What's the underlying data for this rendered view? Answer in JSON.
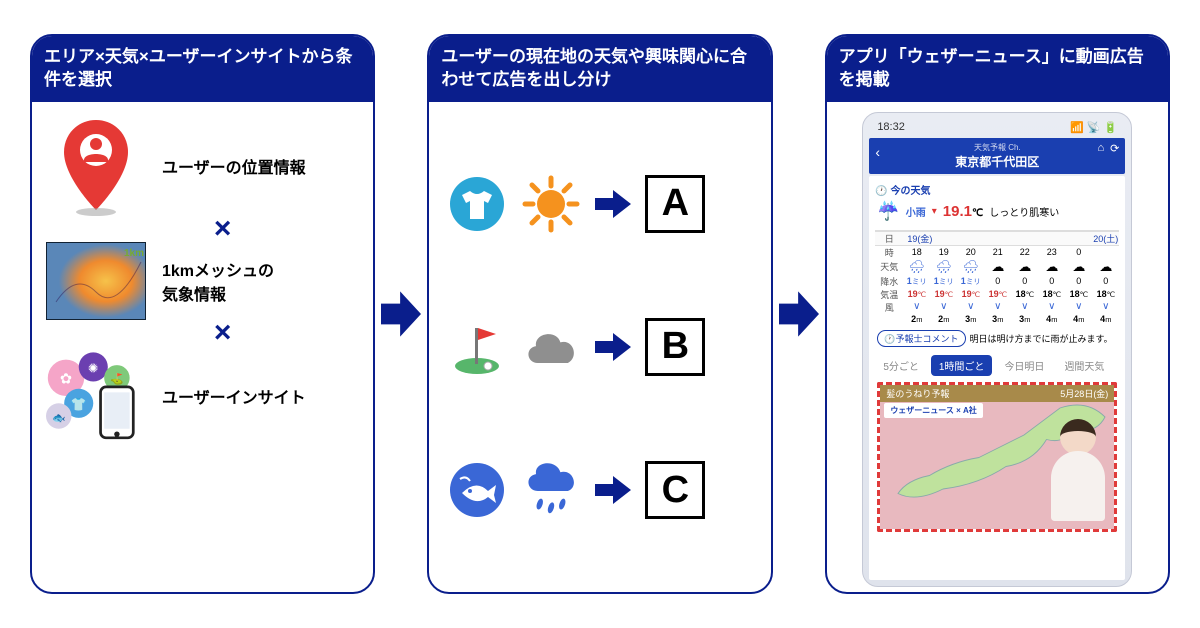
{
  "panel1": {
    "header": "エリア×天気×ユーザーインサイトから条件を選択",
    "row1_label": "ユーザーの位置情報",
    "row2_label": "1kmメッシュの\n気象情報",
    "row3_label": "ユーザーインサイト",
    "map_badge": "1km",
    "sep": "×"
  },
  "panel2": {
    "header": "ユーザーの現在地の天気や興味関心に合わせて広告を出し分け",
    "rows": [
      {
        "insight_icon": "tshirt",
        "weather_icon": "sun",
        "ad": "A"
      },
      {
        "insight_icon": "golf",
        "weather_icon": "cloud",
        "ad": "B"
      },
      {
        "insight_icon": "fish",
        "weather_icon": "rain",
        "ad": "C"
      }
    ]
  },
  "panel3": {
    "header": "アプリ「ウェザーニュース」に動画広告を掲載",
    "status_time": "18:32",
    "status_icons": "📶 📡 🔋",
    "app_sub": "天気予報 Ch.",
    "app_location": "東京都千代田区",
    "now_header": "🕐 今の天気",
    "now_cond": "小雨",
    "now_temp_num": "19.1",
    "now_temp_unit": "℃",
    "now_feel": "しっとり肌寒い",
    "day1": "19(金)",
    "day2": "20(土)",
    "row_labels": {
      "day": "日",
      "hour": "時",
      "weather": "天気",
      "precip": "降水",
      "temp": "気温",
      "wind": "風"
    },
    "hours": [
      "18",
      "19",
      "20",
      "21",
      "22",
      "23",
      "0"
    ],
    "weather_row": [
      "🌧",
      "🌧",
      "🌧",
      "☁",
      "☁",
      "☁",
      "☁",
      "☁"
    ],
    "precip": [
      "1",
      "1",
      "1",
      "0",
      "0",
      "0",
      "0",
      "0"
    ],
    "precip_unit": "ミリ",
    "temps": [
      "19",
      "19",
      "19",
      "19",
      "18",
      "18",
      "18",
      "18"
    ],
    "temp_unit": "℃",
    "wind_dir": [
      "∨",
      "∨",
      "∨",
      "∨",
      "∨",
      "∨",
      "∨",
      "∨"
    ],
    "wind_spd": [
      "2",
      "2",
      "3",
      "3",
      "3",
      "4",
      "4",
      "4"
    ],
    "wind_unit": "m",
    "comment_pill": "🕐予報士コメント",
    "comment_text": "明日は明け方までに雨が止みます。",
    "tabs": [
      "5分ごと",
      "1時間ごと",
      "今日明日",
      "週間天気"
    ],
    "active_tab": 1,
    "ad_title": "髪のうねり予報",
    "ad_date": "5月28日(金)",
    "ad_collab": "ウェザーニュース × A社"
  }
}
